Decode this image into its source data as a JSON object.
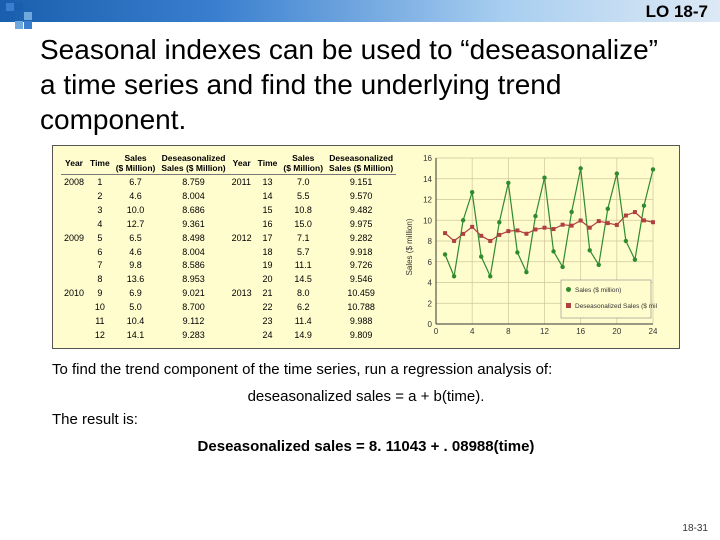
{
  "header": {
    "lo": "LO 18-7"
  },
  "title": "Seasonal indexes can be used to “deseasonalize” a time series and find the underlying trend component.",
  "table": {
    "cols": [
      "Year",
      "Time",
      "Sales ($ Million)",
      "Deseasonalized Sales ($ Million)",
      "Year",
      "Time",
      "Sales ($ Million)",
      "Deseasonalized Sales ($ Million)"
    ],
    "rows": [
      [
        "2008",
        "1",
        "6.7",
        "8.759",
        "2011",
        "13",
        "7.0",
        "9.151"
      ],
      [
        "",
        "2",
        "4.6",
        "8.004",
        "",
        "14",
        "5.5",
        "9.570"
      ],
      [
        "",
        "3",
        "10.0",
        "8.686",
        "",
        "15",
        "10.8",
        "9.482"
      ],
      [
        "",
        "4",
        "12.7",
        "9.361",
        "",
        "16",
        "15.0",
        "9.975"
      ],
      [
        "2009",
        "5",
        "6.5",
        "8.498",
        "2012",
        "17",
        "7.1",
        "9.282"
      ],
      [
        "",
        "6",
        "4.6",
        "8.004",
        "",
        "18",
        "5.7",
        "9.918"
      ],
      [
        "",
        "7",
        "9.8",
        "8.586",
        "",
        "19",
        "11.1",
        "9.726"
      ],
      [
        "",
        "8",
        "13.6",
        "8.953",
        "",
        "20",
        "14.5",
        "9.546"
      ],
      [
        "2010",
        "9",
        "6.9",
        "9.021",
        "2013",
        "21",
        "8.0",
        "10.459"
      ],
      [
        "",
        "10",
        "5.0",
        "8.700",
        "",
        "22",
        "6.2",
        "10.788"
      ],
      [
        "",
        "11",
        "10.4",
        "9.112",
        "",
        "23",
        "11.4",
        "9.988"
      ],
      [
        "",
        "12",
        "14.1",
        "9.283",
        "",
        "24",
        "14.9",
        "9.809"
      ]
    ]
  },
  "chart_data": {
    "type": "line",
    "x": [
      1,
      2,
      3,
      4,
      5,
      6,
      7,
      8,
      9,
      10,
      11,
      12,
      13,
      14,
      15,
      16,
      17,
      18,
      19,
      20,
      21,
      22,
      23,
      24
    ],
    "series": [
      {
        "name": "Sales ($ million)",
        "values": [
          6.7,
          4.6,
          10.0,
          12.7,
          6.5,
          4.6,
          9.8,
          13.6,
          6.9,
          5.0,
          10.4,
          14.1,
          7.0,
          5.5,
          10.8,
          15.0,
          7.1,
          5.7,
          11.1,
          14.5,
          8.0,
          6.2,
          11.4,
          14.9
        ],
        "color": "#2e8b2e",
        "marker": "circle"
      },
      {
        "name": "Deseasonalized Sales ($ million)",
        "values": [
          8.759,
          8.004,
          8.686,
          9.361,
          8.498,
          8.004,
          8.586,
          8.953,
          9.021,
          8.7,
          9.112,
          9.283,
          9.151,
          9.57,
          9.482,
          9.975,
          9.282,
          9.918,
          9.726,
          9.546,
          10.459,
          10.788,
          9.988,
          9.809
        ],
        "color": "#b04040",
        "marker": "square"
      }
    ],
    "ylabel": "Sales ($ million)",
    "ylim": [
      0,
      16
    ],
    "yticks": [
      0,
      2,
      4,
      6,
      8,
      10,
      12,
      14,
      16
    ],
    "xlim": [
      0,
      24
    ],
    "xticks": [
      0,
      4,
      8,
      12,
      16,
      20,
      24
    ],
    "legend": {
      "position": "right-inside"
    }
  },
  "below": {
    "p1": "To find the trend component of the time series, run a regression analysis of:",
    "p2": "deseasonalized sales = a + b(time).",
    "p3": "The result is:",
    "p4": "Deseasonalized sales = 8. 11043 + . 08988(time)"
  },
  "page": "18-31"
}
